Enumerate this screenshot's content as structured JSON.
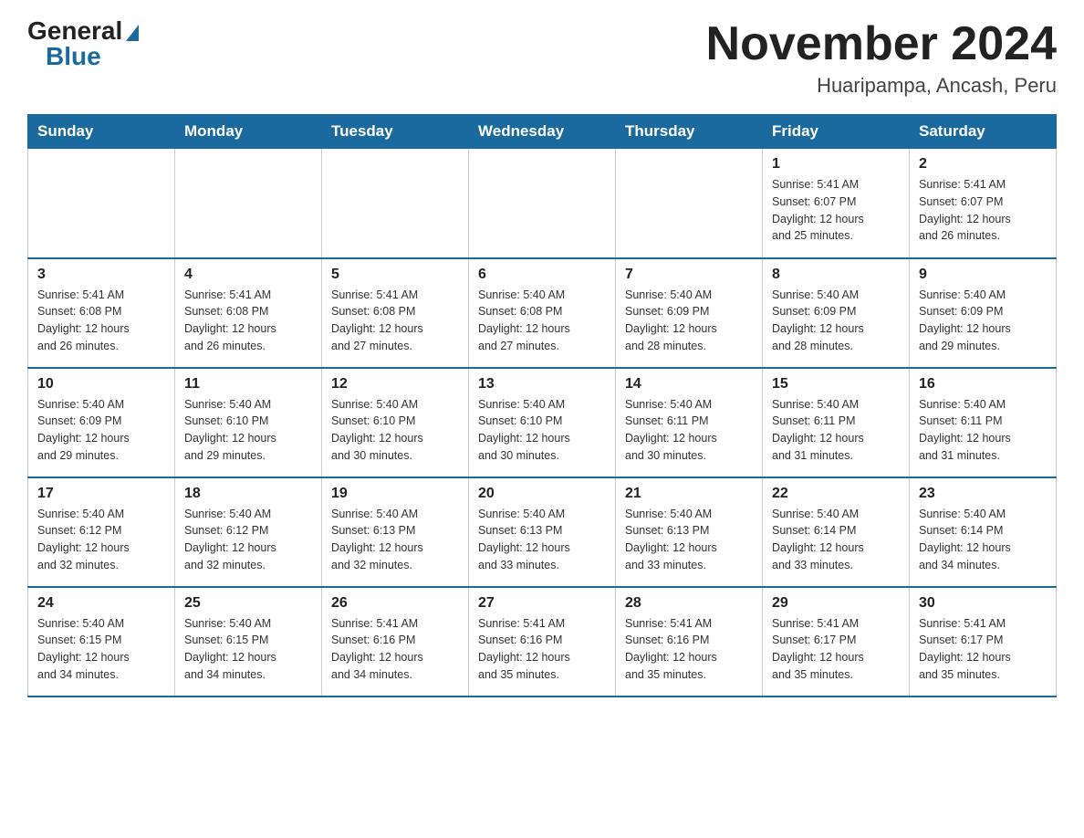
{
  "header": {
    "logo_general": "General",
    "logo_blue": "Blue",
    "month_title": "November 2024",
    "location": "Huaripampa, Ancash, Peru"
  },
  "weekdays": [
    "Sunday",
    "Monday",
    "Tuesday",
    "Wednesday",
    "Thursday",
    "Friday",
    "Saturday"
  ],
  "weeks": [
    [
      {
        "day": "",
        "info": ""
      },
      {
        "day": "",
        "info": ""
      },
      {
        "day": "",
        "info": ""
      },
      {
        "day": "",
        "info": ""
      },
      {
        "day": "",
        "info": ""
      },
      {
        "day": "1",
        "info": "Sunrise: 5:41 AM\nSunset: 6:07 PM\nDaylight: 12 hours\nand 25 minutes."
      },
      {
        "day": "2",
        "info": "Sunrise: 5:41 AM\nSunset: 6:07 PM\nDaylight: 12 hours\nand 26 minutes."
      }
    ],
    [
      {
        "day": "3",
        "info": "Sunrise: 5:41 AM\nSunset: 6:08 PM\nDaylight: 12 hours\nand 26 minutes."
      },
      {
        "day": "4",
        "info": "Sunrise: 5:41 AM\nSunset: 6:08 PM\nDaylight: 12 hours\nand 26 minutes."
      },
      {
        "day": "5",
        "info": "Sunrise: 5:41 AM\nSunset: 6:08 PM\nDaylight: 12 hours\nand 27 minutes."
      },
      {
        "day": "6",
        "info": "Sunrise: 5:40 AM\nSunset: 6:08 PM\nDaylight: 12 hours\nand 27 minutes."
      },
      {
        "day": "7",
        "info": "Sunrise: 5:40 AM\nSunset: 6:09 PM\nDaylight: 12 hours\nand 28 minutes."
      },
      {
        "day": "8",
        "info": "Sunrise: 5:40 AM\nSunset: 6:09 PM\nDaylight: 12 hours\nand 28 minutes."
      },
      {
        "day": "9",
        "info": "Sunrise: 5:40 AM\nSunset: 6:09 PM\nDaylight: 12 hours\nand 29 minutes."
      }
    ],
    [
      {
        "day": "10",
        "info": "Sunrise: 5:40 AM\nSunset: 6:09 PM\nDaylight: 12 hours\nand 29 minutes."
      },
      {
        "day": "11",
        "info": "Sunrise: 5:40 AM\nSunset: 6:10 PM\nDaylight: 12 hours\nand 29 minutes."
      },
      {
        "day": "12",
        "info": "Sunrise: 5:40 AM\nSunset: 6:10 PM\nDaylight: 12 hours\nand 30 minutes."
      },
      {
        "day": "13",
        "info": "Sunrise: 5:40 AM\nSunset: 6:10 PM\nDaylight: 12 hours\nand 30 minutes."
      },
      {
        "day": "14",
        "info": "Sunrise: 5:40 AM\nSunset: 6:11 PM\nDaylight: 12 hours\nand 30 minutes."
      },
      {
        "day": "15",
        "info": "Sunrise: 5:40 AM\nSunset: 6:11 PM\nDaylight: 12 hours\nand 31 minutes."
      },
      {
        "day": "16",
        "info": "Sunrise: 5:40 AM\nSunset: 6:11 PM\nDaylight: 12 hours\nand 31 minutes."
      }
    ],
    [
      {
        "day": "17",
        "info": "Sunrise: 5:40 AM\nSunset: 6:12 PM\nDaylight: 12 hours\nand 32 minutes."
      },
      {
        "day": "18",
        "info": "Sunrise: 5:40 AM\nSunset: 6:12 PM\nDaylight: 12 hours\nand 32 minutes."
      },
      {
        "day": "19",
        "info": "Sunrise: 5:40 AM\nSunset: 6:13 PM\nDaylight: 12 hours\nand 32 minutes."
      },
      {
        "day": "20",
        "info": "Sunrise: 5:40 AM\nSunset: 6:13 PM\nDaylight: 12 hours\nand 33 minutes."
      },
      {
        "day": "21",
        "info": "Sunrise: 5:40 AM\nSunset: 6:13 PM\nDaylight: 12 hours\nand 33 minutes."
      },
      {
        "day": "22",
        "info": "Sunrise: 5:40 AM\nSunset: 6:14 PM\nDaylight: 12 hours\nand 33 minutes."
      },
      {
        "day": "23",
        "info": "Sunrise: 5:40 AM\nSunset: 6:14 PM\nDaylight: 12 hours\nand 34 minutes."
      }
    ],
    [
      {
        "day": "24",
        "info": "Sunrise: 5:40 AM\nSunset: 6:15 PM\nDaylight: 12 hours\nand 34 minutes."
      },
      {
        "day": "25",
        "info": "Sunrise: 5:40 AM\nSunset: 6:15 PM\nDaylight: 12 hours\nand 34 minutes."
      },
      {
        "day": "26",
        "info": "Sunrise: 5:41 AM\nSunset: 6:16 PM\nDaylight: 12 hours\nand 34 minutes."
      },
      {
        "day": "27",
        "info": "Sunrise: 5:41 AM\nSunset: 6:16 PM\nDaylight: 12 hours\nand 35 minutes."
      },
      {
        "day": "28",
        "info": "Sunrise: 5:41 AM\nSunset: 6:16 PM\nDaylight: 12 hours\nand 35 minutes."
      },
      {
        "day": "29",
        "info": "Sunrise: 5:41 AM\nSunset: 6:17 PM\nDaylight: 12 hours\nand 35 minutes."
      },
      {
        "day": "30",
        "info": "Sunrise: 5:41 AM\nSunset: 6:17 PM\nDaylight: 12 hours\nand 35 minutes."
      }
    ]
  ]
}
